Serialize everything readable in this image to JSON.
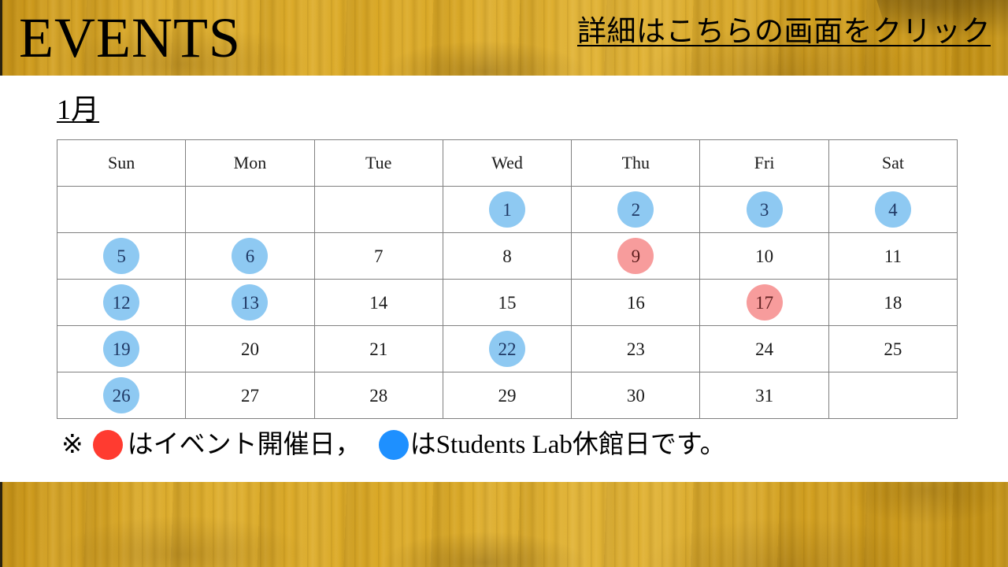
{
  "header": {
    "title": "EVENTS",
    "banner_color": "#d7a523"
  },
  "month_heading": "1月",
  "calendar": {
    "weekday_headers": [
      "Sun",
      "Mon",
      "Tue",
      "Wed",
      "Thu",
      "Fri",
      "Sat"
    ],
    "weeks": [
      [
        {
          "day": "",
          "mark": "none"
        },
        {
          "day": "",
          "mark": "none"
        },
        {
          "day": "",
          "mark": "none"
        },
        {
          "day": "1",
          "mark": "blue"
        },
        {
          "day": "2",
          "mark": "blue"
        },
        {
          "day": "3",
          "mark": "blue"
        },
        {
          "day": "4",
          "mark": "blue"
        }
      ],
      [
        {
          "day": "5",
          "mark": "blue"
        },
        {
          "day": "6",
          "mark": "blue"
        },
        {
          "day": "7",
          "mark": "none"
        },
        {
          "day": "8",
          "mark": "none"
        },
        {
          "day": "9",
          "mark": "red"
        },
        {
          "day": "10",
          "mark": "none"
        },
        {
          "day": "11",
          "mark": "none"
        }
      ],
      [
        {
          "day": "12",
          "mark": "blue"
        },
        {
          "day": "13",
          "mark": "blue"
        },
        {
          "day": "14",
          "mark": "none"
        },
        {
          "day": "15",
          "mark": "none"
        },
        {
          "day": "16",
          "mark": "none"
        },
        {
          "day": "17",
          "mark": "red"
        },
        {
          "day": "18",
          "mark": "none"
        }
      ],
      [
        {
          "day": "19",
          "mark": "blue"
        },
        {
          "day": "20",
          "mark": "none"
        },
        {
          "day": "21",
          "mark": "none"
        },
        {
          "day": "22",
          "mark": "blue"
        },
        {
          "day": "23",
          "mark": "none"
        },
        {
          "day": "24",
          "mark": "none"
        },
        {
          "day": "25",
          "mark": "none"
        }
      ],
      [
        {
          "day": "26",
          "mark": "blue"
        },
        {
          "day": "27",
          "mark": "none"
        },
        {
          "day": "28",
          "mark": "none"
        },
        {
          "day": "29",
          "mark": "none"
        },
        {
          "day": "30",
          "mark": "none"
        },
        {
          "day": "31",
          "mark": "none"
        },
        {
          "day": "",
          "mark": "none"
        }
      ]
    ],
    "mark_colors": {
      "blue": "#8ec9f2",
      "red": "#f79c9c"
    }
  },
  "legend": {
    "note_mark": "※",
    "event_dot_color": "#ff3b30",
    "event_text": "はイベント開催日，",
    "closed_dot_color": "#1e90ff",
    "closed_text": "はStudents Lab休館日です。"
  },
  "footer": {
    "cta_text": "詳細はこちらの画面をクリック"
  }
}
